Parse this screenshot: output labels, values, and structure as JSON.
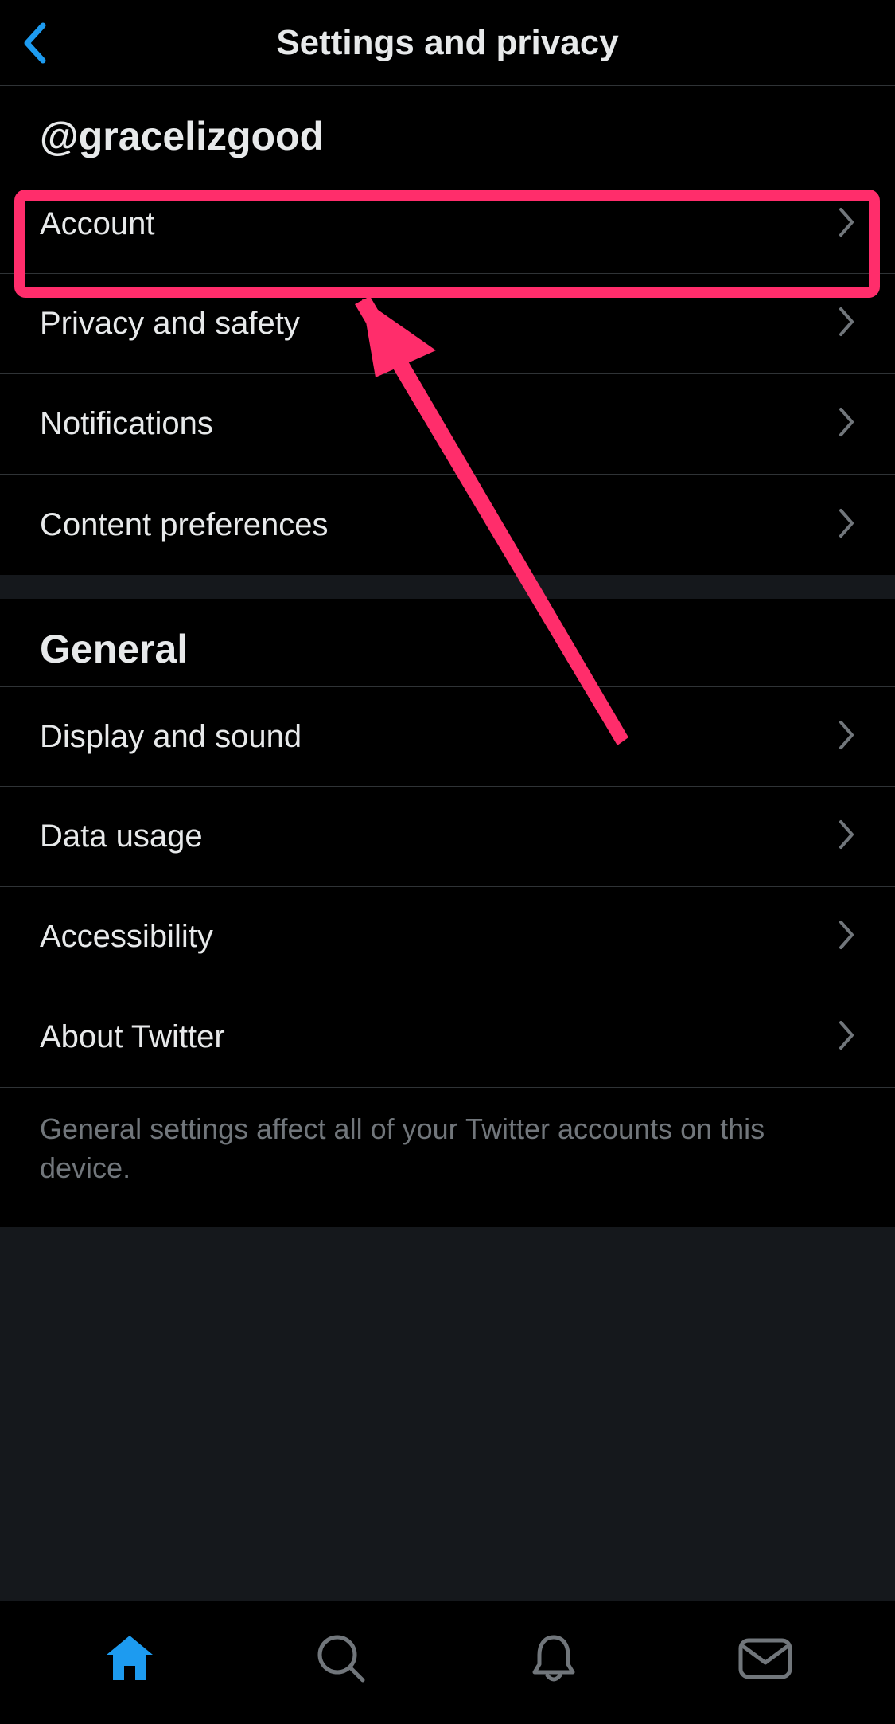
{
  "header": {
    "title": "Settings and privacy"
  },
  "annotation": {
    "highlight_target": "account-row"
  },
  "sections": {
    "user": {
      "title": "@gracelizgood",
      "items": [
        {
          "label": "Account"
        },
        {
          "label": "Privacy and safety"
        },
        {
          "label": "Notifications"
        },
        {
          "label": "Content preferences"
        }
      ]
    },
    "general": {
      "title": "General",
      "items": [
        {
          "label": "Display and sound"
        },
        {
          "label": "Data usage"
        },
        {
          "label": "Accessibility"
        },
        {
          "label": "About Twitter"
        }
      ],
      "footnote": "General settings affect all of your Twitter accounts on this device."
    }
  },
  "tabbar": {
    "items": [
      {
        "name": "home",
        "active": true
      },
      {
        "name": "search",
        "active": false
      },
      {
        "name": "notifications",
        "active": false
      },
      {
        "name": "messages",
        "active": false
      }
    ]
  },
  "colors": {
    "accent": "#1d9bf0",
    "highlight": "#ff2d6b",
    "grey_chevron": "#71767b"
  }
}
